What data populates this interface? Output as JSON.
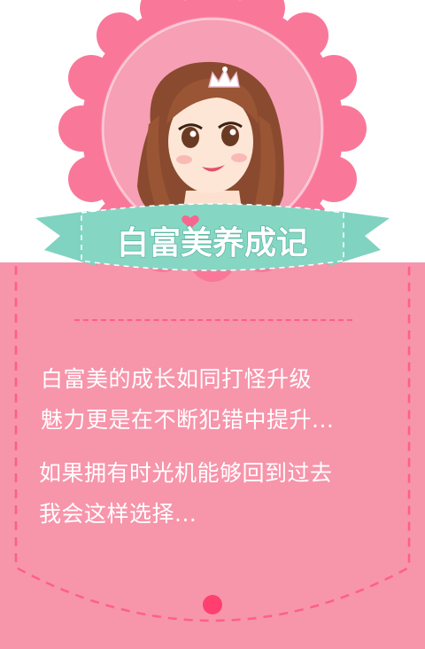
{
  "title": "白富美养成记",
  "intro": {
    "line1": "白富美的成长如同打怪升级",
    "line2": "魅力更是在不断犯错中提升...",
    "line3": "如果拥有时光机能够回到过去",
    "line4": "我会这样选择..."
  },
  "icons": {
    "character": "girl-with-crown-icon",
    "crown": "crown-icon",
    "heart": "heart-icon",
    "dot": "page-dot-icon"
  },
  "colors": {
    "badge_outer": "#f9789a",
    "badge_inner": "#f69fb5",
    "pocket": "#f795ab",
    "pocket_stitch": "#ff5f86",
    "ribbon": "#7fd3c0",
    "ribbon_dark": "#5bb5a2",
    "text": "#ffffff",
    "dot": "#ff3f6e"
  }
}
